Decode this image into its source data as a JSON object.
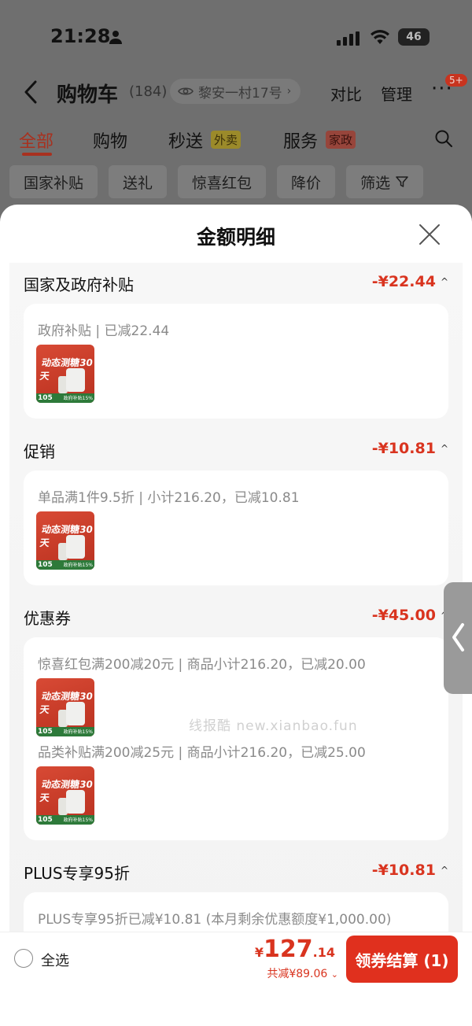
{
  "status_bar": {
    "time": "21:28",
    "battery": "46"
  },
  "nav": {
    "title": "购物车",
    "count": "(184)",
    "address": "黎安一村17号",
    "compare": "对比",
    "manage": "管理",
    "more": "···",
    "badge": "5+"
  },
  "tabs": {
    "all": "全部",
    "shopping": "购物",
    "instant": "秒送",
    "instant_tag": "外卖",
    "services": "服务",
    "services_tag": "家政"
  },
  "filters": [
    "国家补贴",
    "送礼",
    "惊喜红包",
    "降价",
    "筛选"
  ],
  "sheet": {
    "title": "金额明细",
    "sections": {
      "subsidy": {
        "title": "国家及政府补贴",
        "amount": "-¥22.44",
        "line": "政府补贴 | 已减22.44"
      },
      "promo": {
        "title": "促销",
        "amount": "-¥10.81",
        "line": "单品满1件9.5折 | 小计216.20，已减10.81"
      },
      "coupon": {
        "title": "优惠券",
        "amount": "-¥45.00",
        "line1": "惊喜红包满200减20元 | 商品小计216.20，已减20.00",
        "line2": "品类补贴满200减25元 | 商品小计216.20，已减25.00"
      },
      "plus": {
        "title": "PLUS专享95折",
        "amount": "-¥10.81",
        "line": "PLUS专享95折已减¥10.81 (本月剩余优惠额度¥1,000.00)"
      }
    },
    "thumb": {
      "title": "动态测糖30天",
      "price": "105",
      "sub": "政府补贴15%"
    },
    "watermark": "线报酷 new.xianbao.fun"
  },
  "bottom": {
    "select_all": "全选",
    "currency": "¥",
    "price_int": "127",
    "price_dec": ".14",
    "saved": "共减¥89.06",
    "checkout": "领券结算 (1)"
  },
  "colors": {
    "accent": "#d9341f",
    "checkout": "#e0301e"
  }
}
